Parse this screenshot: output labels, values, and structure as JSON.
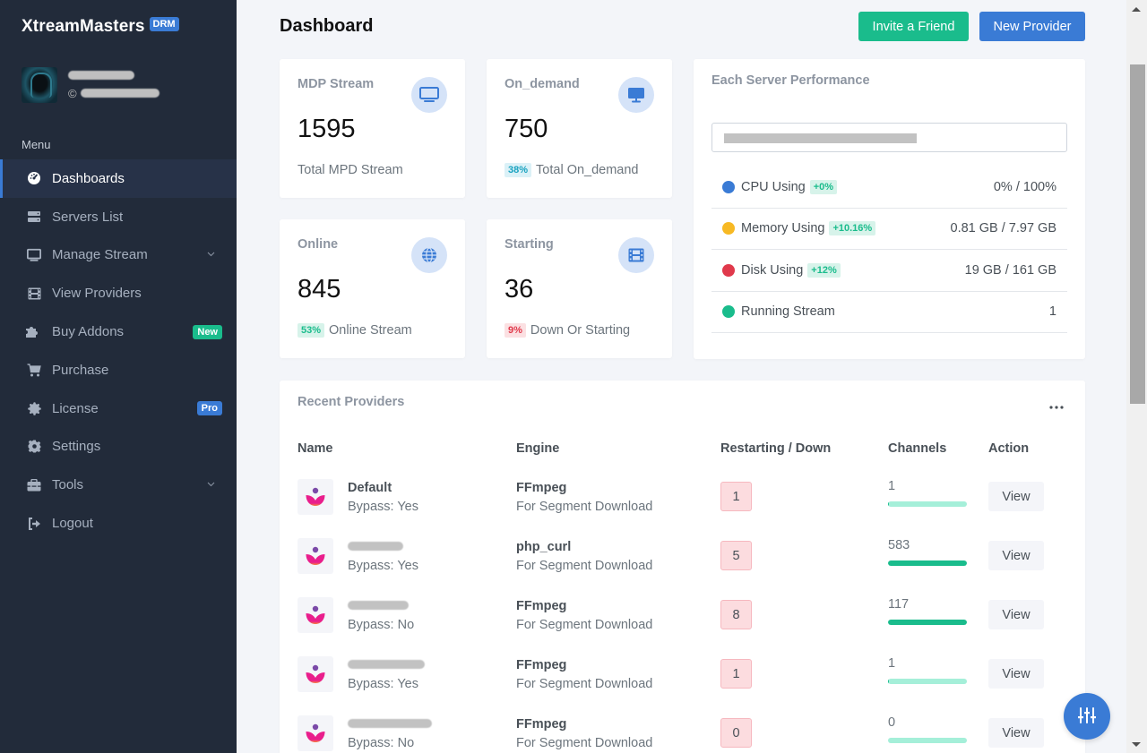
{
  "sidebar": {
    "brand": "XtreamMasters",
    "brand_badge": "DRM",
    "user": {
      "credits_symbol": "©"
    },
    "menu_title": "Menu",
    "items": [
      {
        "label": "Dashboards",
        "icon": "dashboard-icon",
        "active": true
      },
      {
        "label": "Servers List",
        "icon": "server-icon"
      },
      {
        "label": "Manage Stream",
        "icon": "monitor-icon",
        "has_submenu": true
      },
      {
        "label": "View Providers",
        "icon": "film-icon"
      },
      {
        "label": "Buy Addons",
        "icon": "puzzle-icon",
        "badge": "New"
      },
      {
        "label": "Purchase",
        "icon": "cart-icon"
      },
      {
        "label": "License",
        "icon": "certificate-icon",
        "badge": "Pro"
      },
      {
        "label": "Settings",
        "icon": "gear-icon"
      },
      {
        "label": "Tools",
        "icon": "toolbox-icon",
        "has_submenu": true
      },
      {
        "label": "Logout",
        "icon": "logout-icon"
      }
    ]
  },
  "header": {
    "title": "Dashboard",
    "invite_label": "Invite a Friend",
    "new_provider_label": "New Provider"
  },
  "stats": [
    {
      "title": "MDP Stream",
      "value": "1595",
      "footer": "Total MPD Stream",
      "icon": "monitor-icon"
    },
    {
      "title": "On_demand",
      "value": "750",
      "percent": "38%",
      "footer": "Total On_demand",
      "icon": "desktop-icon"
    },
    {
      "title": "Online",
      "value": "845",
      "percent": "53%",
      "footer": "Online Stream",
      "icon": "globe-icon"
    },
    {
      "title": "Starting",
      "value": "36",
      "percent": "9%",
      "footer": "Down Or Starting",
      "icon": "film-icon"
    }
  ],
  "performance": {
    "title": "Each Server Performance",
    "rows": [
      {
        "label": "CPU Using",
        "change": "+0%",
        "value": "0% / 100%",
        "color": "#3a7bd5"
      },
      {
        "label": "Memory Using",
        "change": "+10.16%",
        "value": "0.81 GB / 7.97 GB",
        "color": "#f7b924"
      },
      {
        "label": "Disk Using",
        "change": "+12%",
        "value": "19 GB / 161 GB",
        "color": "#e0394b"
      },
      {
        "label": "Running Stream",
        "value": "1",
        "color": "#1abc8c"
      }
    ]
  },
  "providers": {
    "title": "Recent Providers",
    "columns": [
      "Name",
      "Engine",
      "Restarting / Down",
      "Channels",
      "Action"
    ],
    "rows": [
      {
        "name": "Default",
        "bypass": "Bypass: Yes",
        "engine": "FFmpeg",
        "engine_sub": "For Segment Download",
        "restarting": "1",
        "channels": "1",
        "channels_fill": 0.002,
        "action": "View"
      },
      {
        "name": "",
        "bypass": "Bypass: Yes",
        "engine": "php_curl",
        "engine_sub": "For Segment Download",
        "restarting": "5",
        "channels": "583",
        "channels_fill": 1.0,
        "action": "View"
      },
      {
        "name": "",
        "bypass": "Bypass: No",
        "engine": "FFmpeg",
        "engine_sub": "For Segment Download",
        "restarting": "8",
        "channels": "117",
        "channels_fill": 1.0,
        "action": "View"
      },
      {
        "name": "",
        "bypass": "Bypass: Yes",
        "engine": "FFmpeg",
        "engine_sub": "For Segment Download",
        "restarting": "1",
        "channels": "1",
        "channels_fill": 0.002,
        "action": "View"
      },
      {
        "name": "",
        "bypass": "Bypass: No",
        "engine": "FFmpeg",
        "engine_sub": "For Segment Download",
        "restarting": "0",
        "channels": "0",
        "channels_fill": 0,
        "action": "View"
      }
    ]
  },
  "colors": {
    "primary": "#3a7bd5",
    "success": "#1abc8c",
    "danger": "#e0394b",
    "warning": "#f7b924",
    "sidebar_bg": "#222b3a"
  }
}
